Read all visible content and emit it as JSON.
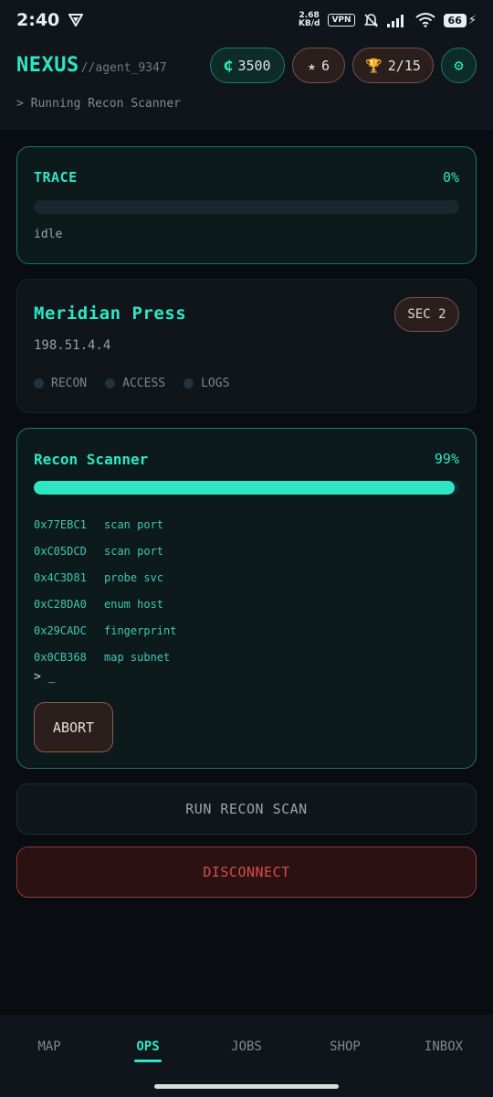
{
  "status_bar": {
    "time": "2:40",
    "net_speed_value": "2.68",
    "net_speed_unit": "KB/d",
    "vpn": "VPN",
    "battery": "66"
  },
  "header": {
    "brand": "NEXUS",
    "agent": "//agent_9347",
    "status": "> Running Recon Scanner",
    "credits_symbol": "₵",
    "credits": "3500",
    "rep_symbol": "★",
    "rep": "6",
    "trophy_symbol": "🏆",
    "trophies": "2/15",
    "settings_symbol": "⚙"
  },
  "trace": {
    "title": "TRACE",
    "percent": "0%",
    "level": 0,
    "status": "idle"
  },
  "target": {
    "name": "Meridian Press",
    "ip": "198.51.4.4",
    "sec": "SEC 2",
    "steps": [
      "RECON",
      "ACCESS",
      "LOGS"
    ]
  },
  "scanner": {
    "title": "Recon Scanner",
    "percent": "99%",
    "level": 0.99,
    "log": [
      {
        "addr": "0x77EBC1",
        "msg": "scan port"
      },
      {
        "addr": "0xC05DCD",
        "msg": "scan port"
      },
      {
        "addr": "0x4C3D81",
        "msg": "probe svc"
      },
      {
        "addr": "0xC28DA0",
        "msg": "enum host"
      },
      {
        "addr": "0x29CADC",
        "msg": "fingerprint"
      },
      {
        "addr": "0x0CB368",
        "msg": "map subnet"
      }
    ],
    "prompt": "> _",
    "abort_label": "ABORT"
  },
  "actions": {
    "run_label": "RUN RECON SCAN",
    "disconnect_label": "DISCONNECT"
  },
  "nav": {
    "items": [
      "MAP",
      "OPS",
      "JOBS",
      "SHOP",
      "INBOX"
    ],
    "active": "OPS"
  },
  "colors": {
    "accent": "#2ee6c4",
    "danger": "#d54e48",
    "warm_border": "#7a5246",
    "background": "#090d11"
  }
}
